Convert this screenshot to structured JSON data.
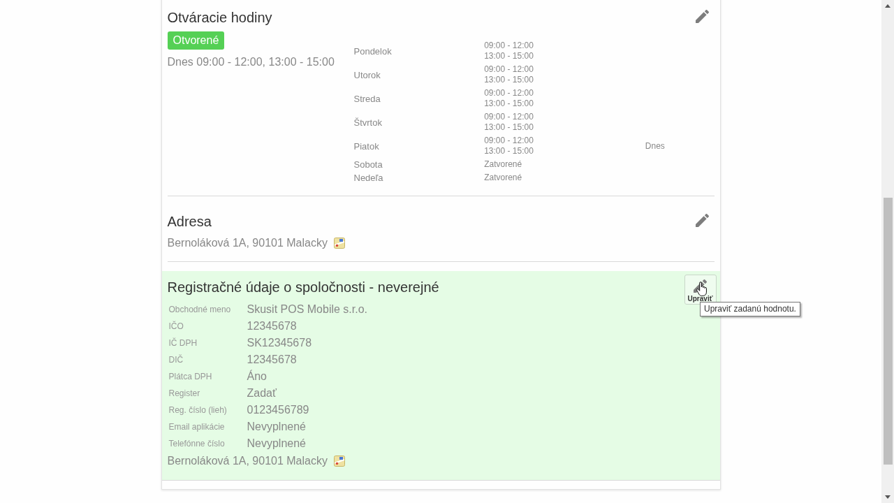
{
  "sections": [
    {
      "kind": "hours",
      "title": "Otváracie hodiny",
      "highlighted": false,
      "edit_button": {
        "hovered": false
      },
      "status": "Otvorené",
      "today": "Dnes 09:00 - 12:00, 13:00 - 15:00",
      "schedule": [
        {
          "day": "Pondelok",
          "hours": [
            "09:00 - 12:00",
            "13:00 - 15:00"
          ]
        },
        {
          "day": "Utorok",
          "hours": [
            "09:00 - 12:00",
            "13:00 - 15:00"
          ]
        },
        {
          "day": "Streda",
          "hours": [
            "09:00 - 12:00",
            "13:00 - 15:00"
          ]
        },
        {
          "day": "Štvrtok",
          "hours": [
            "09:00 - 12:00",
            "13:00 - 15:00"
          ]
        },
        {
          "day": "Piatok",
          "hours": [
            "09:00 - 12:00",
            "13:00 - 15:00"
          ],
          "note": "Dnes"
        },
        {
          "day": "Sobota",
          "hours": [
            "Zatvorené"
          ]
        },
        {
          "day": "Nedeľa",
          "hours": [
            "Zatvorené"
          ]
        }
      ]
    },
    {
      "kind": "address",
      "title": "Adresa",
      "highlighted": false,
      "edit_button": {
        "hovered": false
      },
      "address": "Bernoláková 1A, 90101 Malacky"
    },
    {
      "kind": "registration",
      "title": "Registračné údaje o spoločnosti - neverejné",
      "highlighted": true,
      "edit_button": {
        "hovered": true,
        "label": "Upraviť"
      },
      "fields": [
        {
          "label": "Obchodné meno",
          "value": "Skusit POS Mobile s.r.o."
        },
        {
          "label": "IČO",
          "value": "12345678"
        },
        {
          "label": "IČ DPH",
          "value": "SK12345678"
        },
        {
          "label": "DIČ",
          "value": "12345678"
        },
        {
          "label": "Plátca DPH",
          "value": "Áno"
        },
        {
          "label": "Register",
          "value": "Zadať"
        },
        {
          "label": "Reg. číslo (lieh)",
          "value": "0123456789"
        },
        {
          "label": "Email aplikácie",
          "value": "Nevyplnené"
        },
        {
          "label": "Telefónne číslo",
          "value": "Nevyplnené"
        }
      ],
      "address": "Bernoláková 1A, 90101 Malacky"
    }
  ],
  "tooltip": "Upraviť zadanú hodnotu."
}
